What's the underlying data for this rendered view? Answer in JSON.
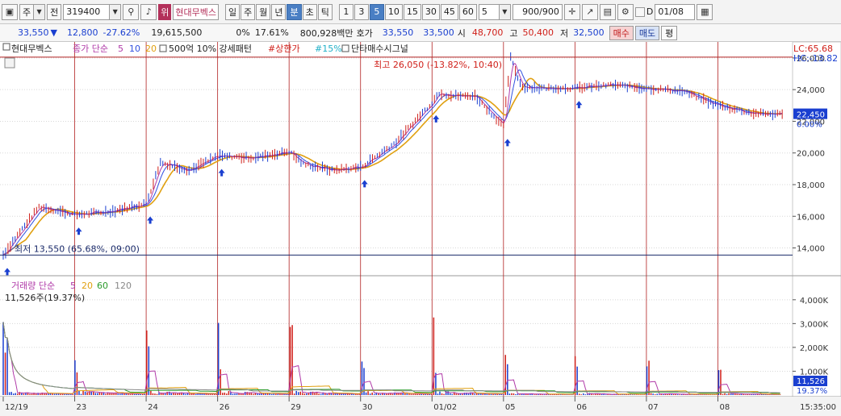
{
  "toolbar": {
    "period_prefix": "주",
    "prev_label": "전",
    "code": "319400",
    "badge": "위",
    "stock_name": "현대무벡스",
    "period_buttons": [
      "일",
      "주",
      "월",
      "년",
      "분",
      "초",
      "틱"
    ],
    "active_period": "분",
    "interval_buttons": [
      "1",
      "3",
      "5",
      "10",
      "15",
      "30",
      "45",
      "60"
    ],
    "active_interval": "5",
    "interval_value": "5",
    "count_value": "900",
    "count_total": "/900",
    "d_label": "D",
    "date_value": "01/08"
  },
  "quote": {
    "price": "33,550",
    "change": "12,800",
    "change_pct": "-27.62%",
    "volume": "19,615,500",
    "v1": "0%",
    "v2": "17.61%",
    "amount": "800,928백만",
    "ask_label": "호가",
    "ask": "33,550",
    "bid": "33,500",
    "open_label": "시",
    "open": "48,700",
    "high_label": "고",
    "high": "50,400",
    "low_label": "저",
    "low": "32,500",
    "buy_label": "매수",
    "sell_label": "매도",
    "flat_label": "평"
  },
  "legend": {
    "name": "현대무벡스",
    "ma_label": "종가 단순",
    "ma1": "5",
    "ma2": "10",
    "ma3": "20",
    "strength": "500억 10% 강세패턴",
    "upper_limit": "#상한가",
    "pct15": "#15%",
    "signal": "단타매수시그널",
    "lc": "LC:65.68",
    "hc": "HC:-13.82"
  },
  "volume_legend": {
    "label": "거래량 단순",
    "ma1": "5",
    "ma2": "20",
    "ma3": "60",
    "ma4": "120",
    "current": "11,526주(19.37%)"
  },
  "annotations": {
    "max_label": "최고 26,050 (-13.82%, 10:40)",
    "min_label": "최저 13,550 (65.68%, 09:00)"
  },
  "price_axis": {
    "ticks": [
      "26,000",
      "24,000",
      "22,000",
      "20,000",
      "18,000",
      "16,000",
      "14,000"
    ],
    "current": "22,450",
    "current_pct": "0.00%"
  },
  "volume_axis": {
    "ticks": [
      "4,000K",
      "3,000K",
      "2,000K",
      "1,000K"
    ],
    "current": "11,526",
    "current_pct": "19.37%"
  },
  "x_axis": {
    "labels": [
      "12/19",
      "23",
      "24",
      "26",
      "29",
      "30",
      "01/02",
      "05",
      "06",
      "07",
      "08"
    ],
    "time": "15:35:00"
  },
  "colors": {
    "up": "#d0201a",
    "down": "#1a3fd0",
    "ma5": "#b03aa8",
    "ma10": "#3050e0",
    "ma20": "#e0a010",
    "vol_ma60": "#2a9a2a",
    "vol_ma120": "#888888",
    "grid": "#d8d8d8",
    "day_line": "#b22222"
  },
  "chart_data": {
    "type": "line",
    "price_ylim": [
      12500,
      26300
    ],
    "volume_ylim": [
      0,
      4400000
    ],
    "day_labels": [
      "12/19",
      "23",
      "24",
      "26",
      "29",
      "30",
      "01/02",
      "05",
      "06",
      "07",
      "08"
    ],
    "series": [
      {
        "name": "종가",
        "x": [
          0,
          0.15,
          0.5,
          1,
          1.5,
          2,
          2.2,
          2.6,
          3,
          3.5,
          4,
          4.2,
          4.6,
          5,
          5.5,
          6,
          6.1,
          6.3,
          6.6,
          7,
          7.1,
          7.25,
          7.5,
          8,
          8.5,
          9,
          9.5,
          10,
          10.5,
          10.9
        ],
        "y": [
          13550,
          14500,
          16600,
          16100,
          16300,
          16800,
          19400,
          18900,
          19800,
          19700,
          20100,
          19300,
          18900,
          19100,
          20700,
          23200,
          23800,
          23600,
          23600,
          21700,
          26000,
          24200,
          24100,
          24100,
          24300,
          24100,
          23900,
          23000,
          22500,
          22450
        ]
      }
    ],
    "buy_signal_days": [
      0,
      1,
      2,
      3,
      5,
      6,
      7,
      8
    ],
    "max": {
      "value": 26050,
      "pct": "-13.82%",
      "time": "10:40"
    },
    "min": {
      "value": 13550,
      "pct": "65.68%",
      "time": "09:00"
    }
  }
}
